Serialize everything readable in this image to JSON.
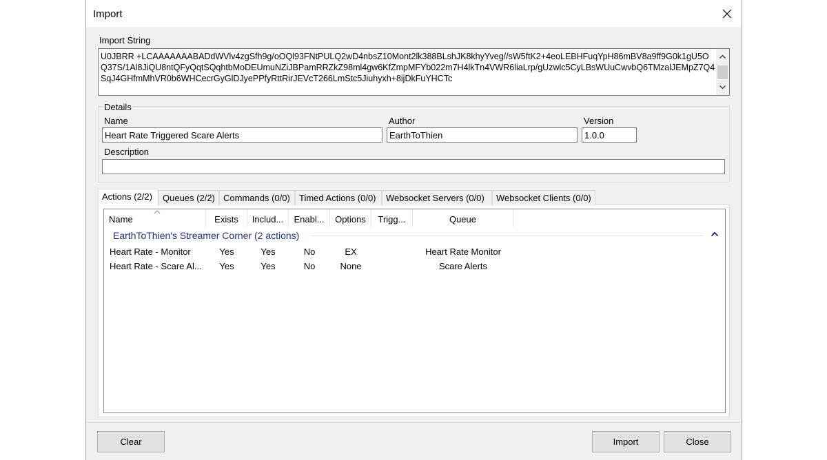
{
  "window": {
    "title": "Import"
  },
  "import_string": {
    "label": "Import String",
    "value": "U0JBRR +LCAAAAAAABADdWVlv4zgSfh9g/oOQl93FNtPULQ2wD4nbsZ10Mont2lk388BLshJK8khyYveg//sW5ftK2+4eoLEBHFuqYpH86mBV8a9ff9G0k1gU5OQ37S/1Al8JiQU8ntQFyQqtSQqhtbMoDEUmuNZiJBPamRRZkZ98ml4gw6KfZmpMFYb022m7H4lkTn4VWR6liaLrp/gUzwlc5CyLBsWUuCwvbQ6TMzalJEMpZ7Q4SqJ4GHfmMhVR0b6WHCecrGyGlDJyePPfyRttRirJEVcT266LmStc5Jiuhyxh+8ijDkFuYHCTc"
  },
  "details": {
    "label": "Details",
    "name_label": "Name",
    "name_value": "Heart Rate Triggered Scare Alerts",
    "author_label": "Author",
    "author_value": "EarthToThien",
    "version_label": "Version",
    "version_value": "1.0.0",
    "description_label": "Description",
    "description_value": ""
  },
  "tabs": [
    {
      "label": "Actions (2/2)",
      "active": true
    },
    {
      "label": "Queues (2/2)"
    },
    {
      "label": "Commands (0/0)"
    },
    {
      "label": "Timed Actions (0/0)"
    },
    {
      "label": "Websocket Servers (0/0)"
    },
    {
      "label": "Websocket Clients (0/0)"
    }
  ],
  "list": {
    "columns": [
      "Name",
      "Exists",
      "Includ...",
      "Enabl...",
      "Options",
      "Trigg...",
      "Queue"
    ],
    "group_title": "EarthToThien's Streamer Corner (2 actions)",
    "rows": [
      {
        "name": "Heart Rate - Monitor",
        "exists": "Yes",
        "included": "Yes",
        "enabled": "No",
        "options": "EX",
        "triggers": "",
        "queue": "Heart Rate Monitor"
      },
      {
        "name": "Heart Rate - Scare Al...",
        "exists": "Yes",
        "included": "Yes",
        "enabled": "No",
        "options": "None",
        "triggers": "",
        "queue": "Scare Alerts"
      }
    ]
  },
  "buttons": {
    "clear": "Clear",
    "import": "Import",
    "close": "Close"
  }
}
